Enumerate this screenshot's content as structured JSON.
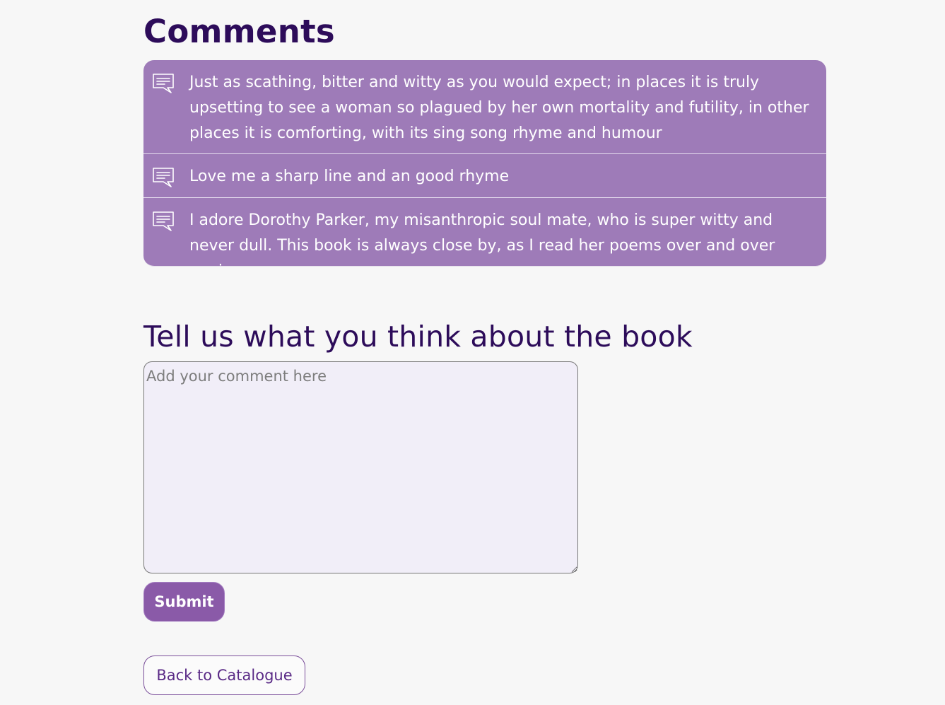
{
  "comments_section": {
    "title": "Comments",
    "items": [
      {
        "icon": "comment-icon",
        "text": "Just as scathing, bitter and witty as you would expect; in places it is truly upsetting to see a woman so plagued by her own mortality and futility, in other places it is comforting, with its sing song rhyme and humour"
      },
      {
        "icon": "comment-icon",
        "text": "Love me a sharp line and an good rhyme"
      },
      {
        "icon": "comment-icon",
        "text": "I adore Dorothy Parker, my misanthropic soul mate, who is super witty and never dull. This book is always close by, as I read her poems over and over again."
      }
    ]
  },
  "form": {
    "title": "Tell us what you think about the book",
    "textarea_value": "",
    "textarea_placeholder": "Add your comment here",
    "submit_label": "Submit"
  },
  "navigation": {
    "back_label": "Back to Catalogue"
  },
  "colors": {
    "accent": "#9e7bb8",
    "heading": "#2d0c5a",
    "button": "#8a5aa8",
    "background": "#f7f7f7"
  }
}
